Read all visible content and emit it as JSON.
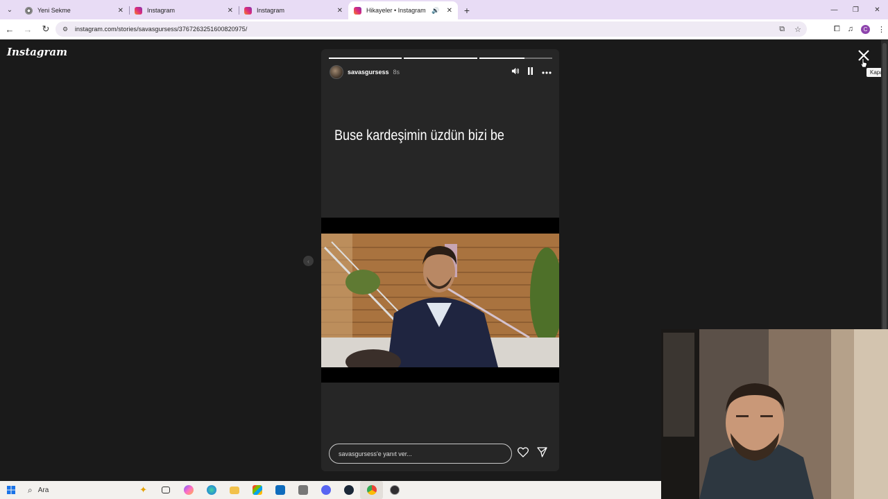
{
  "browser": {
    "tabs": [
      {
        "title": "Yeni Sekme",
        "active": false,
        "icon": "chrome-icon"
      },
      {
        "title": "Instagram",
        "active": false,
        "icon": "instagram-icon"
      },
      {
        "title": "Instagram",
        "active": false,
        "icon": "instagram-icon"
      },
      {
        "title": "Hikayeler • Instagram",
        "active": true,
        "icon": "instagram-icon",
        "audio": true
      }
    ],
    "url": "instagram.com/stories/savasgursess/3767263251600820975/",
    "profile_initial": "C"
  },
  "page": {
    "logo": "Instagram",
    "close_tooltip": "Kapat"
  },
  "story": {
    "username": "savasgursess",
    "age": "8s",
    "text": "Buse kardeşimin üzdün bizi be",
    "progress": [
      1.0,
      1.0,
      0.62
    ],
    "reply_placeholder": "savasgursess'e yanıt ver..."
  },
  "taskbar": {
    "search_label": "Ara"
  },
  "colors": {
    "page_bg": "#1a1a1a",
    "card_bg": "#262626",
    "tabbar_bg": "#e8dcf5"
  }
}
